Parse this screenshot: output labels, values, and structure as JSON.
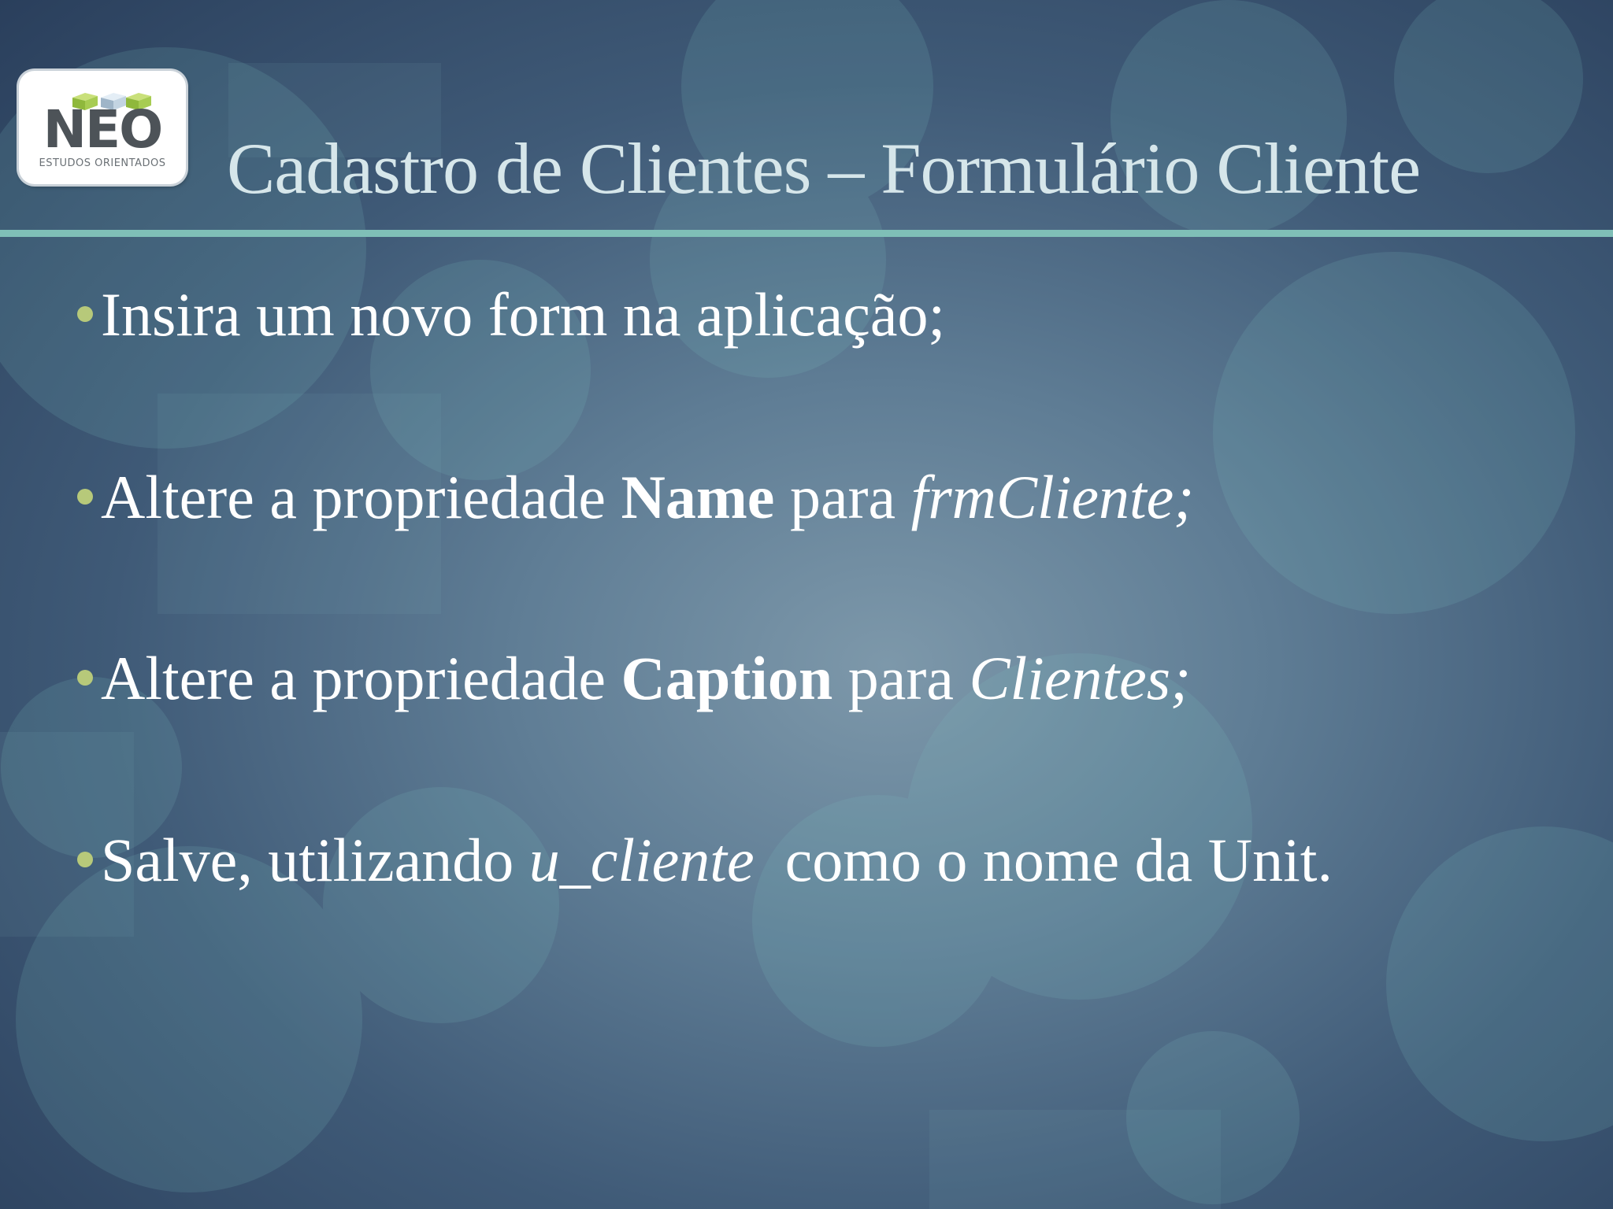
{
  "logo": {
    "word": "NEO",
    "subtitle": "ESTUDOS ORIENTADOS"
  },
  "slide": {
    "title": "Cadastro de Clientes – Formulário Cliente",
    "bullets": [
      {
        "text": "Insira um novo form na aplicação;"
      },
      {
        "before": "Altere a propriedade ",
        "bold": "Name",
        "middle": " para ",
        "italic": "frmCliente;"
      },
      {
        "before": "Altere a propriedade ",
        "bold": "Caption",
        "middle": " para ",
        "italic": "Clientes;"
      },
      {
        "before": "Salve, utilizando ",
        "italic": "u_cliente",
        "after": "  como o nome da Unit."
      }
    ]
  },
  "colors": {
    "title": "#d6e6ea",
    "rule": "#7fbfb7",
    "bullet_dot": "#b7c97a",
    "text": "#ffffff"
  }
}
